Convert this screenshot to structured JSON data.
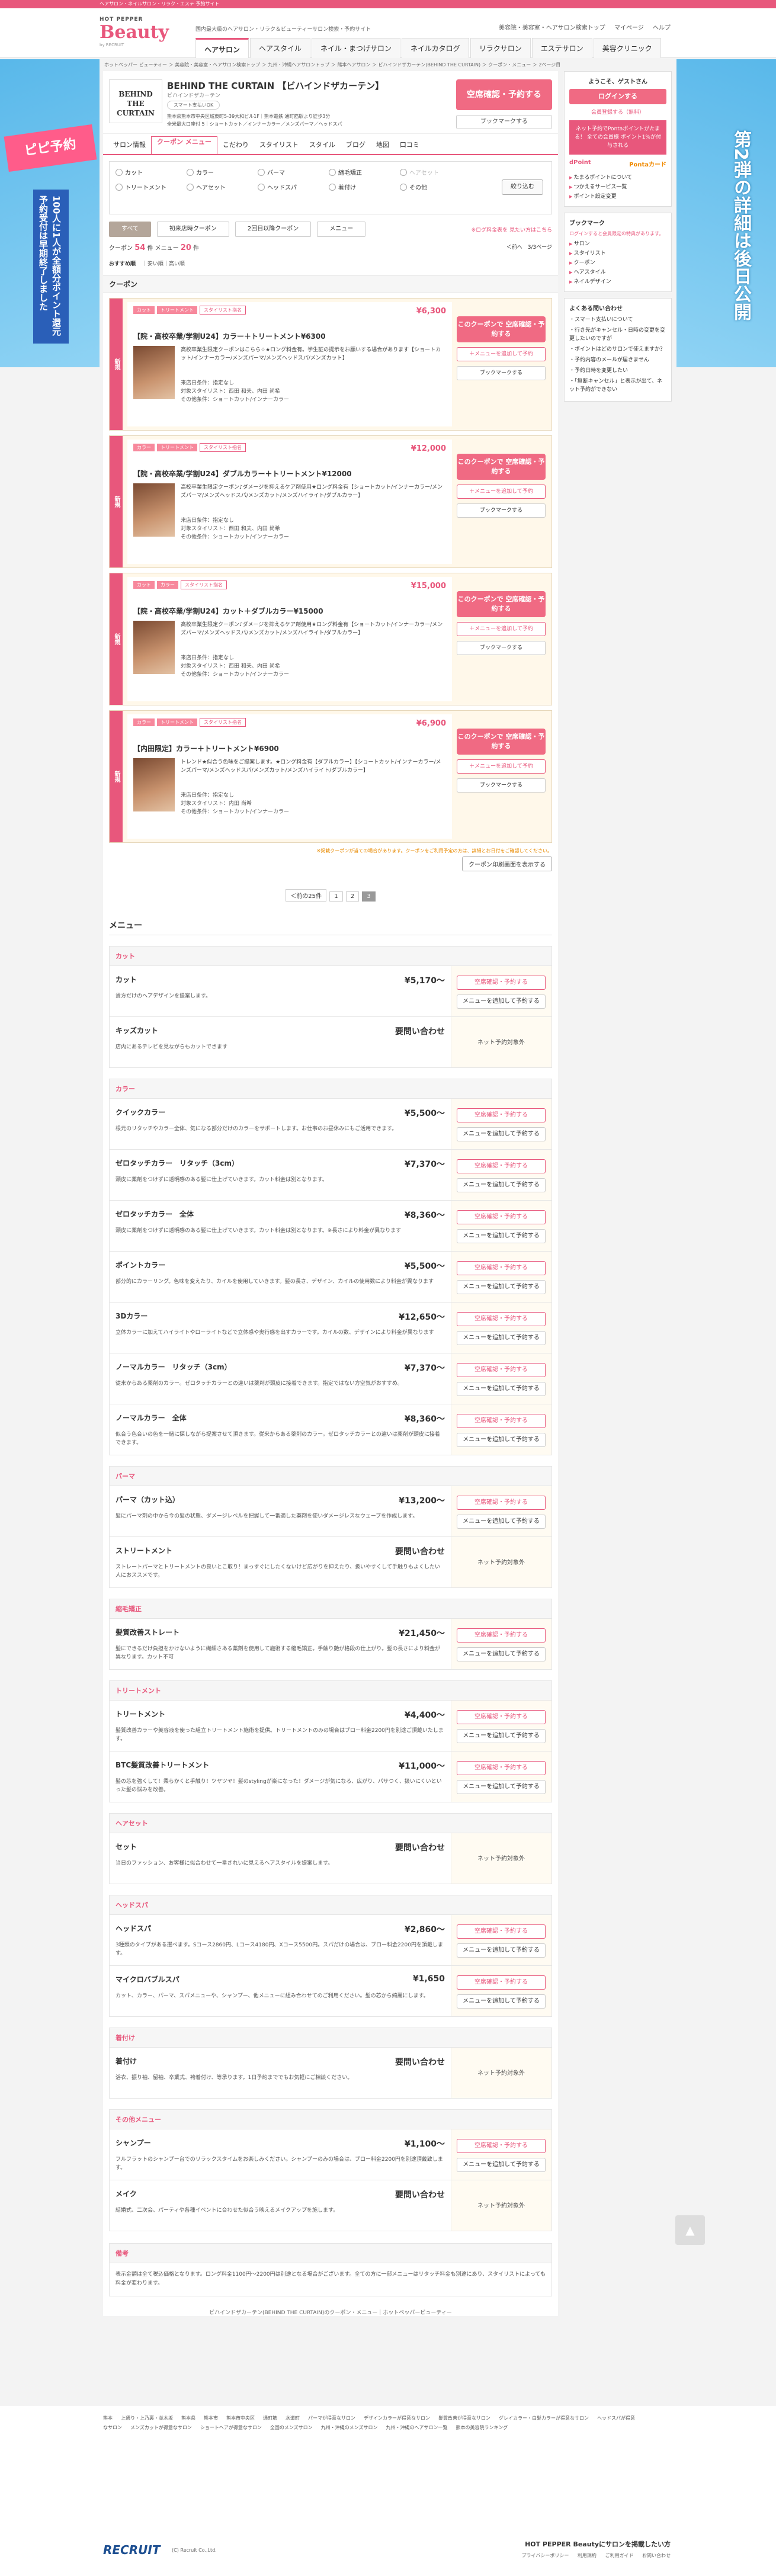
{
  "topbar": "ヘアサロン・ネイルサロン・リラク・エステ 予約サイト",
  "header": {
    "brand_hp": "HOT PEPPER",
    "brand_beauty": "Beauty",
    "brand_recruit": "by RECRUIT",
    "tagline": "国内最大級のヘアサロン・リラク＆ビューティーサロン検索・予約サイト",
    "links": [
      "美容院・美容室・ヘアサロン検索トップ",
      "マイページ",
      "ヘルプ"
    ],
    "nav": [
      "ヘアサロン",
      "ヘアスタイル",
      "ネイル・まつげサロン",
      "ネイルカタログ",
      "リラクサロン",
      "エステサロン",
      "美容クリニック"
    ]
  },
  "left_banner": {
    "pink": "ピピ予約",
    "vertical": "100人に1人が全額分ポイント還元 予約受付は早期終了しました"
  },
  "right_banner": {
    "vertical": "第2弾の詳細は後日公開"
  },
  "breadcrumb": [
    "ホットペッパー ビューティー",
    "美容院・美容室・ヘアサロン検索トップ",
    "九州・沖縄ヘアサロントップ",
    "熊本ヘアサロン",
    "ビハインドザカーテン(BEHIND THE CURTAIN)",
    "クーポン・メニュー",
    "2ページ目"
  ],
  "salon": {
    "logo": "BEHIND THE CURTAIN",
    "name": "BEHIND THE CURTAIN 【ビハインドザカーテン】",
    "kana": "ビハインドザカーテン",
    "pill": "スマート支払いOK",
    "addr": "熊本県熊本市中央区城東町5-39大和ビル1F｜熊本電鉄 通町筋駅より徒歩3分",
    "access": "全米最大口座付 5｜ショートカット／インナーカラー／メンズパーマ／ヘッドスパ",
    "reserve": "空席確認・予約する",
    "bookmark": "ブックマークする"
  },
  "salon_tabs": [
    "サロン情報",
    "クーポン メニュー",
    "こだわり",
    "スタイリスト",
    "スタイル",
    "ブログ",
    "地図",
    "口コミ"
  ],
  "filters": [
    "カット",
    "カラー",
    "パーマ",
    "縮毛矯正",
    "ヘアセット",
    "トリートメント",
    "ヘアセット",
    "ヘッドスパ",
    "着付け",
    "その他"
  ],
  "filter_btn": "絞り込む",
  "coupon_tabs": [
    "すべて",
    "初来店時クーポン",
    "2回目以降クーポン",
    "メニュー"
  ],
  "coupon_note": "※ログ料金表を 見たい方はこちら",
  "counts": {
    "coupons_label": "クーポン",
    "coupons": "54",
    "menus_label": "件 メニュー",
    "menus": "20",
    "menus_unit": "件",
    "pager": "＜前へ　3/3ページ"
  },
  "sort": {
    "label": "おすすめ順",
    "opts": "｜安い順｜高い順"
  },
  "coupon_section": "クーポン",
  "coupons": [
    {
      "band": "新規",
      "tags": [
        "カット",
        "トリートメント",
        "スタイリスト指名"
      ],
      "price": "¥6,300",
      "title": "【院・高校卒業/学割U24】カラー＋トリートメント¥6300",
      "desc": "高校卒業生限定クーポンはこちら☆★ロング料金有。学生証の提示をお願いする場合があります【ショートカット/インナーカラー/メンズパーマ/メンズヘッドスパ/メンズカット】",
      "m1": "来店日条件：指定なし",
      "m2": "対象スタイリスト：西田 和夫、内田 尚希",
      "m3": "その他条件：ショートカット/インナーカラー",
      "btn": "このクーポンで 空席確認・予約する",
      "add": "＋メニューを追加して予約",
      "bm": "ブックマークする"
    },
    {
      "band": "新規",
      "tags": [
        "カラー",
        "トリートメント",
        "スタイリスト指名"
      ],
      "price": "¥12,000",
      "title": "【院・高校卒業/学割U24】ダブルカラー＋トリートメント¥12000",
      "desc": "高校卒業生限定クーポン♪ダメージを抑えるケア剤使用★ロング料金有【ショートカット/インナーカラー/メンズパーマ/メンズヘッドスパ/メンズカット/メンズハイライト/ダブルカラー】",
      "m1": "来店日条件：指定なし",
      "m2": "対象スタイリスト：西田 和夫、内田 尚希",
      "m3": "その他条件：ショートカット/インナーカラー",
      "btn": "このクーポンで 空席確認・予約する",
      "add": "＋メニューを追加して予約",
      "bm": "ブックマークする"
    },
    {
      "band": "新規",
      "tags": [
        "カット",
        "カラー",
        "スタイリスト指名"
      ],
      "price": "¥15,000",
      "title": "【院・高校卒業/学割U24】カット＋ダブルカラー¥15000",
      "desc": "高校卒業生限定クーポン♪ダメージを抑えるケア剤使用★ロング料金有【ショートカット/インナーカラー/メンズパーマ/メンズヘッドスパ/メンズカット/メンズハイライト/ダブルカラー】",
      "m1": "来店日条件：指定なし",
      "m2": "対象スタイリスト：西田 和夫、内田 尚希",
      "m3": "その他条件：ショートカット/インナーカラー",
      "btn": "このクーポンで 空席確認・予約する",
      "add": "＋メニューを追加して予約",
      "bm": "ブックマークする"
    },
    {
      "band": "新規",
      "tags": [
        "カラー",
        "トリートメント",
        "スタイリスト指名"
      ],
      "price": "¥6,900",
      "title": "【内田限定】カラー＋トリートメント¥6900",
      "desc": "トレンド★似合う色味をご提案します。★ロング料金有【ダブルカラー】【ショートカット/インナーカラー/メンズパーマ/メンズヘッドスパ/メンズカット/メンズハイライト/ダブルカラー】",
      "m1": "来店日条件：指定なし",
      "m2": "対象スタイリスト：内田 尚希",
      "m3": "その他条件：ショートカット/インナーカラー",
      "btn": "このクーポンで 空席確認・予約する",
      "add": "＋メニューを追加して予約",
      "bm": "ブックマークする"
    }
  ],
  "coupon_footnote": "※掲載クーポンが当ての場合があります。クーポンをご利用予定の方は、詳細とお日付をご確認してください。",
  "coupon_print": "クーポン印刷画面を表示する",
  "pagination": [
    "＜前の25件",
    "1",
    "2",
    "3"
  ],
  "menu_title": "メニュー",
  "menu_cats": [
    {
      "name": "カット",
      "items": [
        {
          "n": "カット",
          "p": "¥5,170〜",
          "d": "貴方だけのヘアデザインを提案します。",
          "b1": "空席確認・予約する",
          "b2": "メニューを追加して予約する"
        },
        {
          "n": "キッズカット",
          "p": "要問い合わせ",
          "d": "店内にあるテレビを見ながらもカットできます",
          "ni": "ネット予約対象外"
        }
      ]
    },
    {
      "name": "カラー",
      "items": [
        {
          "n": "クイックカラー",
          "p": "¥5,500〜",
          "d": "根元のリタッチやカラー全体、気になる部分だけのカラーをサポートします。お仕事のお昼休みにもご活用できます。",
          "b1": "空席確認・予約する",
          "b2": "メニューを追加して予約する"
        },
        {
          "n": "ゼロタッチカラー　リタッチ（3cm）",
          "p": "¥7,370〜",
          "d": "頭皮に薬剤をつけずに透明感のある髪に仕上げていきます。カット料金は別となります。",
          "b1": "空席確認・予約する",
          "b2": "メニューを追加して予約する"
        },
        {
          "n": "ゼロタッチカラー　全体",
          "p": "¥8,360〜",
          "d": "頭皮に薬剤をつけずに透明感のある髪に仕上げていきます。カット料金は別となります。※長さにより料金が異なります",
          "b1": "空席確認・予約する",
          "b2": "メニューを追加して予約する"
        },
        {
          "n": "ポイントカラー",
          "p": "¥5,500〜",
          "d": "部分的にカラーリング。色味を変えたり、カイルを使用していきます。髪の長さ、デザイン、カイルの使用数により料金が異なります",
          "b1": "空席確認・予約する",
          "b2": "メニューを追加して予約する"
        },
        {
          "n": "3Dカラー",
          "p": "¥12,650〜",
          "d": "立体カラーに加えてハイライトやローライトなどで立体感や奥行感を出すカラーです。カイルの数、デザインにより料金が異なります",
          "b1": "空席確認・予約する",
          "b2": "メニューを追加して予約する"
        },
        {
          "n": "ノーマルカラー　リタッチ（3cm）",
          "p": "¥7,370〜",
          "d": "従来からある薬剤のカラー。ゼロタッチカラーとの違いは薬剤が頭皮に接着できます。指定ではない方空気がおすすめ。",
          "b1": "空席確認・予約する",
          "b2": "メニューを追加して予約する"
        },
        {
          "n": "ノーマルカラー　全体",
          "p": "¥8,360〜",
          "d": "似合う色合いの色を一緒に探しながら提案させて頂きます。従来からある薬剤のカラー。ゼロタッチカラーとの違いは薬剤が頭皮に接着できます。",
          "b1": "空席確認・予約する",
          "b2": "メニューを追加して予約する"
        }
      ]
    },
    {
      "name": "パーマ",
      "items": [
        {
          "n": "パーマ（カット込）",
          "p": "¥13,200〜",
          "d": "髪にパーマ剤の中から今の髪の状態、ダメージレベルを把握して一番適した薬剤を使いダメージレスなウェーブを作成します。",
          "b1": "空席確認・予約する",
          "b2": "メニューを追加して予約する"
        },
        {
          "n": "ストリートメント",
          "p": "要問い合わせ",
          "d": "ストレートパーマとトリートメントの良いとこ取り！まっすぐにしたくないけど広がりを抑えたり、扱いやすくして手触りもよくしたい人におススメです。",
          "ni": "ネット予約対象外"
        }
      ]
    },
    {
      "name": "縮毛矯正",
      "items": [
        {
          "n": "髪質改善ストレート",
          "p": "¥21,450〜",
          "d": "髪にできるだけ負担をかけないように繊細さある薬剤を使用して施術する縮毛矯正。手触り艶が格段の仕上がり。髪の長さにより料金が異なります。カット不可",
          "b1": "空席確認・予約する",
          "b2": "メニューを追加して予約する"
        }
      ]
    },
    {
      "name": "トリートメント",
      "items": [
        {
          "n": "トリートメント",
          "p": "¥4,400〜",
          "d": "髪質改善カラーや美容液を使った組立トリートメント施術を提供。トリートメントのみの場合はブロー料金2200円を別途ご頂戴いたします。",
          "b1": "空席確認・予約する",
          "b2": "メニューを追加して予約する"
        },
        {
          "n": "BTC髪質改善トリートメント",
          "p": "¥11,000〜",
          "d": "髪の芯を強くして！柔らかくと手触り！ツヤツヤ！髪のstylingが楽になった！ダメージが気になる、広がり、パサつく、扱いにくいといった髪の悩みを改善。",
          "b1": "空席確認・予約する",
          "b2": "メニューを追加して予約する"
        }
      ]
    },
    {
      "name": "ヘアセット",
      "items": [
        {
          "n": "セット",
          "p": "要問い合わせ",
          "d": "当日のファッション、お客様に似合わせて一番きれいに見えるヘアスタイルを提案します。",
          "ni": "ネット予約対象外"
        }
      ]
    },
    {
      "name": "ヘッドスパ",
      "items": [
        {
          "n": "ヘッドスパ",
          "p": "¥2,860〜",
          "d": "3種類のタイプがある選べます。Sコース2860円、Lコース4180円、Xコース5500円。スパだけの場合は、ブロー料金2200円を頂戴します。",
          "b1": "空席確認・予約する",
          "b2": "メニューを追加して予約する"
        },
        {
          "n": "マイクロバブルスパ",
          "p": "¥1,650",
          "d": "カット、カラー、パーマ、スパメニューや、シャンプー、他メニューに組み合わせてのご利用ください。髪の芯から綺麗にします。",
          "b1": "空席確認・予約する",
          "b2": "メニューを追加して予約する"
        }
      ]
    },
    {
      "name": "着付け",
      "items": [
        {
          "n": "着付け",
          "p": "要問い合わせ",
          "d": "浴衣、振り袖、留袖、卒業式、袴着付け、等承ります。1日予約まででもお気軽にご相談ください。",
          "ni": "ネット予約対象外"
        }
      ]
    },
    {
      "name": "その他メニュー",
      "items": [
        {
          "n": "シャンプー",
          "p": "¥1,100〜",
          "d": "フルフラットのシャンプー台でのリラックスタイムをお楽しみください。シャンプーのみの場合は、ブロー料金2200円を別途頂戴致します。",
          "b1": "空席確認・予約する",
          "b2": "メニューを追加して予約する"
        },
        {
          "n": "メイク",
          "p": "要問い合わせ",
          "d": "結婚式、二次会、パーティや各種イベントに合わせた似合う映えるメイクアップを施します。",
          "ni": "ネット予約対象外"
        }
      ]
    }
  ],
  "bikou_title": "備考",
  "bikou": "表示金額は全て税込価格となります。ロング料金1100円〜2200円は別途となる場合がございます。全ての方に一部メニューはリタッチ料金も別途にあり、スタイリストによっても料金が変わります。",
  "page_footnote": "ビハインドザカーテン(BEHIND THE CURTAIN)のクーポン・メニュー｜ホットペッパービューティー",
  "side": {
    "welcome": "ようこそ、ゲストさん",
    "login": "ログインする",
    "register": "会員登録する（無料）",
    "point_text": "ネット予約でPontaポイントがたまる！ 全ての会員様 ポイント1%が付与される",
    "point_logos": [
      "Pontaカード",
      "dPoint"
    ],
    "links": [
      "たまるポイントについて",
      "つかえるサービス一覧",
      "ポイント設定変更"
    ],
    "bm_title": "ブックマーク",
    "bm_note": "ログインすると会員限定の特典があります。",
    "bm_items": [
      "サロン",
      "スタイリスト",
      "クーポン",
      "ヘアスタイル",
      "ネイルデザイン"
    ],
    "faq_title": "よくある問い合わせ",
    "faq": [
      "スマート支払いについて",
      "行き先がキャンセル・日時の変更を変更したいのですが",
      "ポイントはどのサロンで使えますか？",
      "予約内容のメールが届きません",
      "予約日時を変更したい",
      "「無断キャンセル」と表示が出て、ネット予約ができない"
    ]
  },
  "footer": {
    "links": [
      "熊本",
      "上通り・上乃裏・並木坂",
      "熊本県",
      "熊本市",
      "熊本市中央区",
      "通町筋",
      "水道町",
      "パーマが得意なサロン",
      "デザインカラーが得意なサロン",
      "髪質改善が得意なサロン",
      "グレイカラー・白髪カラーが得意なサロン",
      "ヘッドスパが得意なサロン",
      "メンズカットが得意なサロン",
      "ショートヘアが得意なサロン",
      "全国のメンズサロン",
      "九州・沖縄のメンズサロン",
      "九州・沖縄のヘアサロン一覧",
      "熊本の美容院ランキング"
    ],
    "recruit": "RECRUIT",
    "copy": "(C) Recruit Co.,Ltd.",
    "msg": "HOT PEPPER Beautyにサロンを掲載したい方",
    "bottom_links": [
      "プライバシーポリシー",
      "利用規約",
      "ご利用ガイド",
      "お問い合わせ"
    ]
  }
}
